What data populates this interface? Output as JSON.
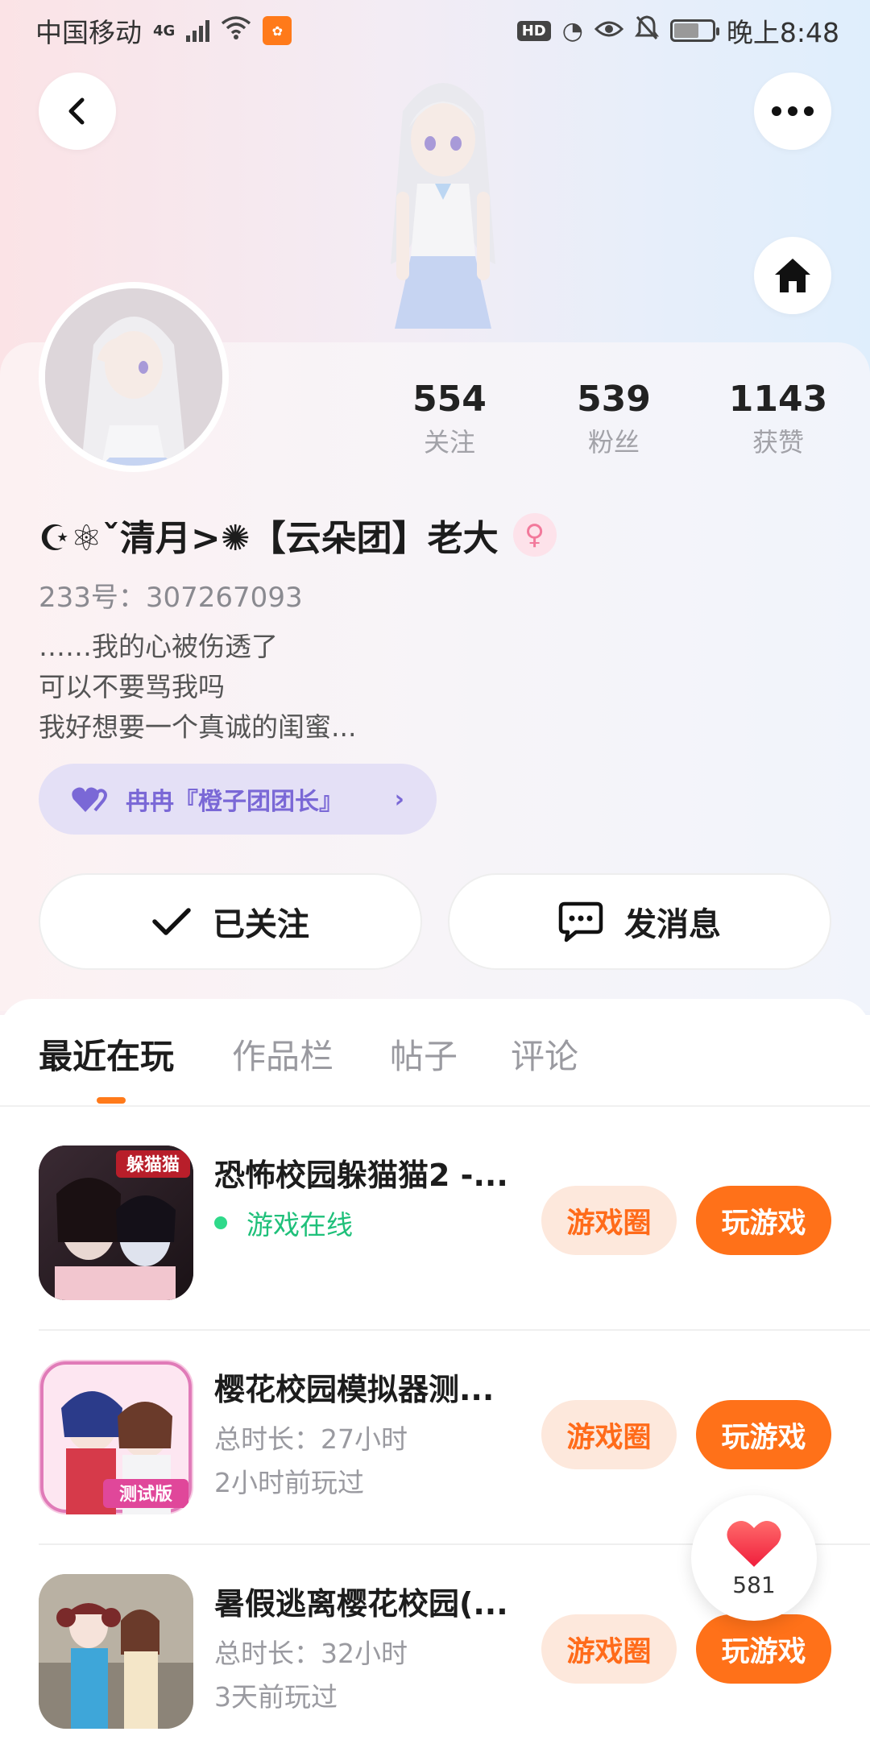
{
  "status_bar": {
    "carrier": "中国移动",
    "network": "4G",
    "hd": "HD",
    "time": "晚上8:48"
  },
  "profile": {
    "stats": [
      {
        "value": "554",
        "label": "关注"
      },
      {
        "value": "539",
        "label": "粉丝"
      },
      {
        "value": "1143",
        "label": "获赞"
      }
    ],
    "nickname": "☪︎⚛︎ˇ清月>✺【云朵团】老大",
    "uid": "233号：307267093",
    "bio": [
      "……我的心被伤透了",
      "可以不要骂我吗",
      "我好想要一个真诚的闺蜜..."
    ],
    "relation": "冉冉『橙子团团长』",
    "follow_label": "已关注",
    "message_label": "发消息"
  },
  "tabs": [
    {
      "label": "最近在玩",
      "active": true
    },
    {
      "label": "作品栏",
      "active": false
    },
    {
      "label": "帖子",
      "active": false
    },
    {
      "label": "评论",
      "active": false
    }
  ],
  "games": [
    {
      "title": "恐怖校园躲猫猫2 -...",
      "line1": "游戏在线",
      "line2": "",
      "online": true,
      "thumb_text": "躲猫猫"
    },
    {
      "title": "樱花校园模拟器测...",
      "line1": "总时长：27小时",
      "line2": "2小时前玩过",
      "online": false,
      "thumb_text": "测试版"
    },
    {
      "title": "暑假逃离樱花校园(...",
      "line1": "总时长：32小时",
      "line2": "3天前玩过",
      "online": false,
      "thumb_text": ""
    }
  ],
  "game_buttons": {
    "circle": "游戏圈",
    "play": "玩游戏"
  },
  "like_count": "581",
  "colors": {
    "accent": "#ff7119",
    "online": "#1fc07a",
    "relation": "#7a68d6"
  }
}
